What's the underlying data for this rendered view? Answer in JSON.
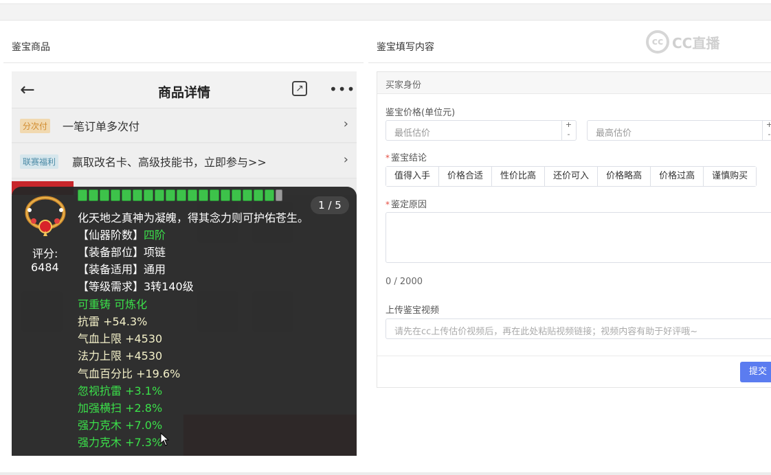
{
  "left_section": {
    "title": "鉴宝商品"
  },
  "right_section": {
    "title": "鉴宝填写内容"
  },
  "watermark": {
    "text": "CC直播"
  },
  "phone": {
    "header": {
      "back": "←",
      "title": "商品详情",
      "share": "↗",
      "more": "•••"
    },
    "promos": [
      {
        "tag": "分次付",
        "text": "一笔订单多次付",
        "arrow": "›",
        "tag_color": "#f1d9b0",
        "tag_text_color": "#d08a2d"
      },
      {
        "tag": "联赛福利",
        "text": "赢取改名卡、高级技能书，立即参与>>",
        "arrow": "›",
        "tag_color": "#d6e6ec",
        "tag_text_color": "#4b8aa6"
      }
    ]
  },
  "tooltip": {
    "score_label": "评分:",
    "score_value": "6484",
    "page_badge": "1 / 5",
    "refine_level": {
      "filled": 18,
      "total": 19
    },
    "lines": [
      {
        "text": "化天地之真神为凝魄，得其念力则可护佑苍生。",
        "color": "white"
      },
      {
        "text": "【仙器阶数】",
        "value": "四阶",
        "color": "white",
        "value_color": "green"
      },
      {
        "text": "【装备部位】项链",
        "color": "white"
      },
      {
        "text": "【装备适用】通用",
        "color": "white"
      },
      {
        "text": "【等级需求】3转140级",
        "color": "white"
      },
      {
        "text": "可重铸 可炼化",
        "color": "green"
      },
      {
        "text": "抗雷 +54.3%",
        "color": "yellow"
      },
      {
        "text": "气血上限 +4530",
        "color": "yellow"
      },
      {
        "text": "法力上限 +4530",
        "color": "yellow"
      },
      {
        "text": "气血百分比 +19.6%",
        "color": "yellow"
      },
      {
        "text": "忽视抗雷 +3.1%",
        "color": "green"
      },
      {
        "text": "加强横扫 +2.8%",
        "color": "green"
      },
      {
        "text": "强力克木 +7.0%",
        "color": "green"
      },
      {
        "text": "强力克木 +7.3%",
        "color": "green"
      }
    ]
  },
  "form": {
    "buyer_identity": "买家身份",
    "price_label": "鉴宝价格(单位元)",
    "min_placeholder": "最低估价",
    "max_placeholder": "最高估价",
    "conclusion_label": "鉴宝结论",
    "conclusions": [
      "值得入手",
      "价格合适",
      "性价比高",
      "还价可入",
      "价格略高",
      "价格过高",
      "谨慎购买"
    ],
    "reason_label": "鉴定原因",
    "counter": "0 / 2000",
    "video_label": "上传鉴宝视频",
    "video_placeholder": "请先在cc上传估价视频后，再在此处粘贴视频链接；视频内容有助于好评哦~",
    "submit": "提交",
    "accent": "#5b7cf0"
  }
}
